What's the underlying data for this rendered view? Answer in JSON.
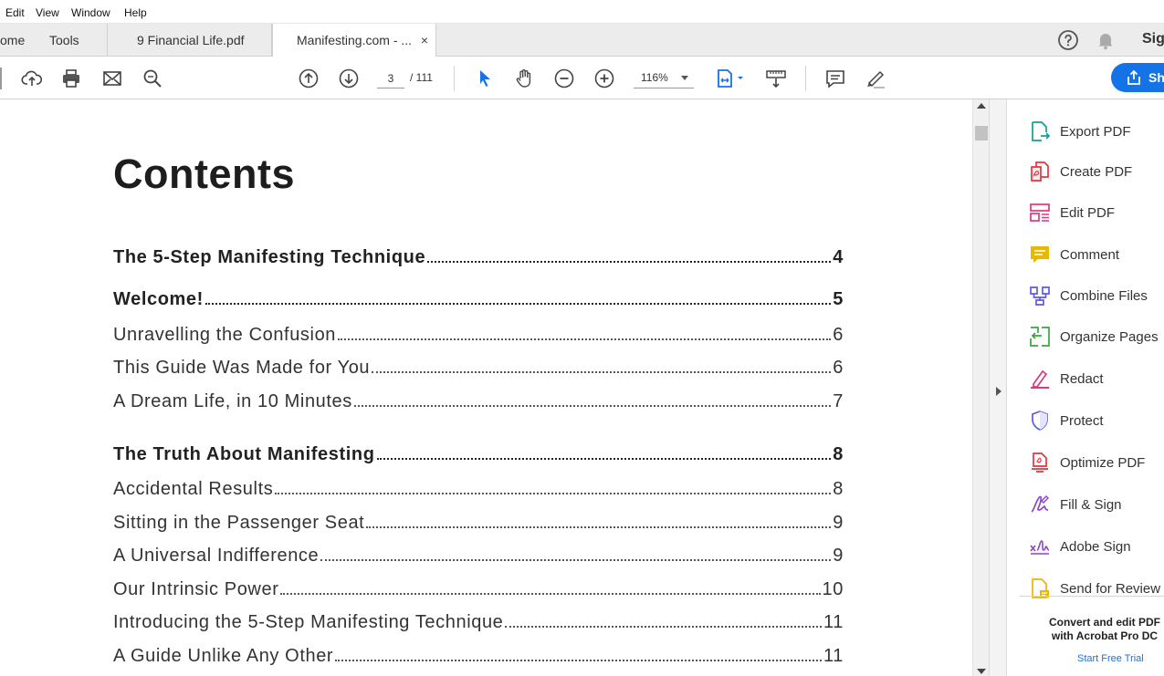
{
  "menubar": {
    "items": [
      "Edit",
      "View",
      "Window",
      "Help"
    ]
  },
  "tabs": {
    "home": "ome",
    "tools": "Tools",
    "files": [
      {
        "label": "9 Financial Life.pdf"
      },
      {
        "label": "Manifesting.com - ...",
        "close": "×"
      }
    ]
  },
  "header_right": {
    "sign_label": "Sig"
  },
  "toolbar": {
    "page_current": "3",
    "page_total": "/ 111",
    "zoom": "116%",
    "share_label": "Sh"
  },
  "document": {
    "title": "Contents",
    "entries": [
      {
        "title": "The 5-Step Manifesting Technique",
        "page": "4",
        "major": true
      },
      {
        "title": "Welcome!",
        "page": "5",
        "major": true
      },
      {
        "title": "Unravelling the Confusion",
        "page": "6",
        "major": false
      },
      {
        "title": "This Guide Was Made for You",
        "page": "6",
        "major": false
      },
      {
        "title": "A Dream Life, in 10 Minutes",
        "page": "7",
        "major": false
      },
      {
        "title": "The Truth About Manifesting",
        "page": "8",
        "major": true
      },
      {
        "title": "Accidental Results",
        "page": "8",
        "major": false
      },
      {
        "title": "Sitting in the Passenger Seat",
        "page": "9",
        "major": false
      },
      {
        "title": "A Universal Indifference",
        "page": "9",
        "major": false
      },
      {
        "title": "Our Intrinsic Power",
        "page": "10",
        "major": false
      },
      {
        "title": "Introducing the 5-Step Manifesting Technique",
        "page": "11",
        "major": false
      },
      {
        "title": "A Guide Unlike Any Other",
        "page": "11",
        "major": false
      }
    ]
  },
  "tools_pane": {
    "items": [
      {
        "label": "Export PDF",
        "icon": "export-pdf-icon",
        "color": "#1a9b9b"
      },
      {
        "label": "Create PDF",
        "icon": "create-pdf-icon",
        "color": "#e5343d"
      },
      {
        "label": "Edit PDF",
        "icon": "edit-pdf-icon",
        "color": "#e0367e"
      },
      {
        "label": "Comment",
        "icon": "comment-icon",
        "color": "#e6b800"
      },
      {
        "label": "Combine Files",
        "icon": "combine-files-icon",
        "color": "#5c5ce0"
      },
      {
        "label": "Organize Pages",
        "icon": "organize-pages-icon",
        "color": "#3fa33f"
      },
      {
        "label": "Redact",
        "icon": "redact-icon",
        "color": "#e0367e"
      },
      {
        "label": "Protect",
        "icon": "protect-icon",
        "color": "#5c5ce0"
      },
      {
        "label": "Optimize PDF",
        "icon": "optimize-pdf-icon",
        "color": "#e5343d"
      },
      {
        "label": "Fill & Sign",
        "icon": "fill-sign-icon",
        "color": "#8a45c8"
      },
      {
        "label": "Adobe Sign",
        "icon": "adobe-sign-icon",
        "color": "#8a45c8"
      },
      {
        "label": "Send for Review",
        "icon": "send-review-icon",
        "color": "#e6b800"
      }
    ],
    "promo_line1": "Convert and edit PDF",
    "promo_line2": "with Acrobat Pro DC",
    "promo_link": "Start Free Trial"
  }
}
